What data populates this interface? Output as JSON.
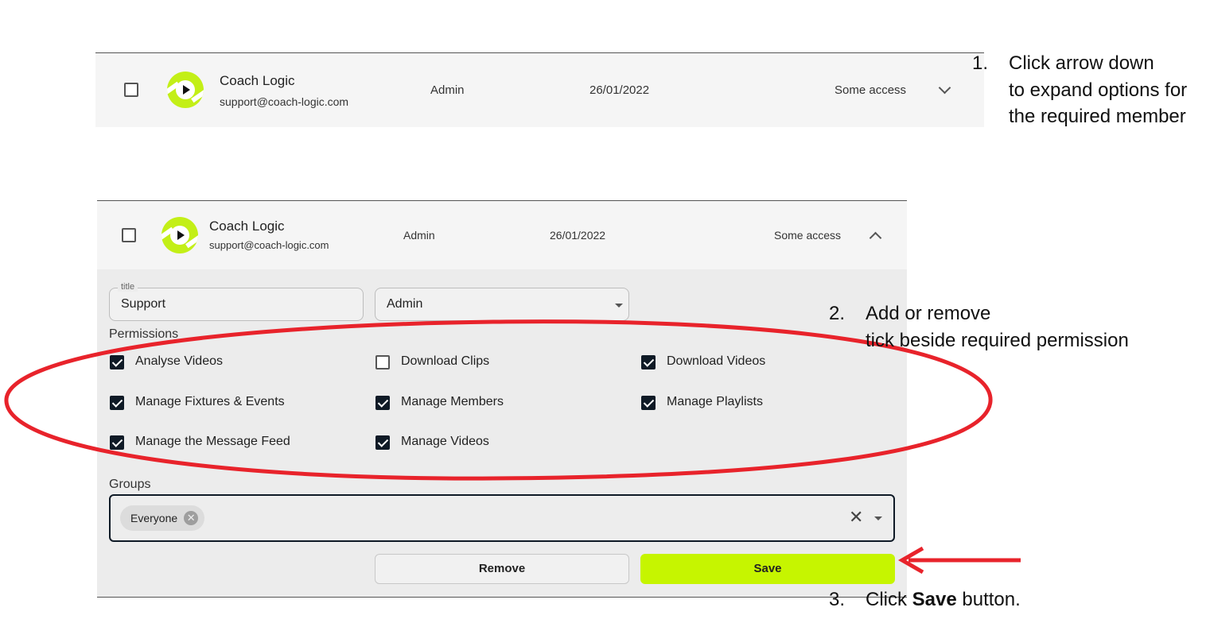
{
  "collapsed_row": {
    "name": "Coach Logic",
    "email": "support@coach-logic.com",
    "role": "Admin",
    "date": "26/01/2022",
    "access": "Some access"
  },
  "expanded_row": {
    "name": "Coach Logic",
    "email": "support@coach-logic.com",
    "role": "Admin",
    "date": "26/01/2022",
    "access": "Some access",
    "title_field": {
      "legend": "title",
      "value": "Support"
    },
    "role_select": {
      "value": "Admin"
    },
    "permissions_label": "Permissions",
    "permissions": [
      {
        "label": "Analyse Videos",
        "checked": true
      },
      {
        "label": "Download Clips",
        "checked": false
      },
      {
        "label": "Download Videos",
        "checked": true
      },
      {
        "label": "Manage Fixtures & Events",
        "checked": true
      },
      {
        "label": "Manage Members",
        "checked": true
      },
      {
        "label": "Manage Playlists",
        "checked": true
      },
      {
        "label": "Manage the Message Feed",
        "checked": true
      },
      {
        "label": "Manage Videos",
        "checked": true
      }
    ],
    "groups_label": "Groups",
    "groups": [
      {
        "label": "Everyone"
      }
    ],
    "remove_label": "Remove",
    "save_label": "Save"
  },
  "annotations": {
    "step1": {
      "number": "1.",
      "lines": [
        "Click arrow down",
        "to expand options for",
        "the required member"
      ]
    },
    "step2": {
      "number": "2.",
      "lines": [
        "Add or remove",
        "tick beside required permission"
      ]
    },
    "step3": {
      "number": "3.",
      "before": "Click ",
      "bold": "Save",
      "after": " button."
    }
  },
  "colors": {
    "accent": "#c6f500",
    "checkbox_fill": "#0f1a26",
    "annotation_red": "#e8232b"
  },
  "icons": [
    "coach-logic-logo",
    "chevron-down-icon",
    "chevron-up-icon",
    "caret-down-icon",
    "close-icon",
    "checkmark-icon",
    "arrow-left-icon"
  ]
}
